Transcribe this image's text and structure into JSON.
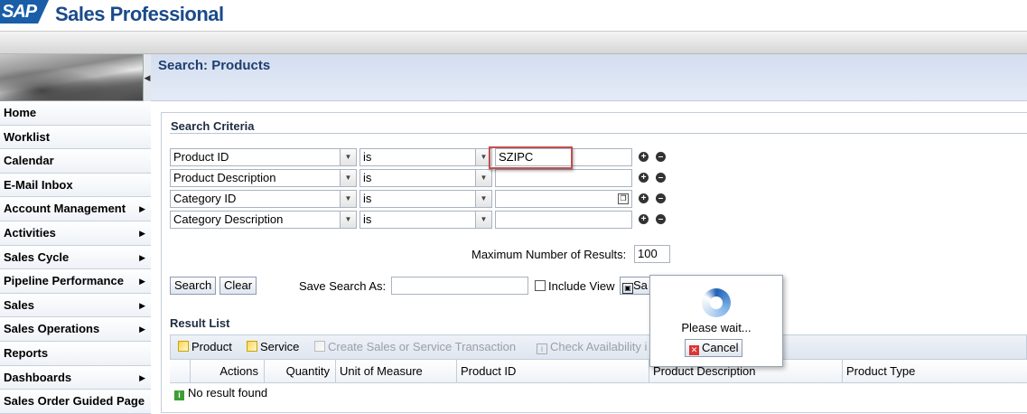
{
  "app": {
    "logo": "SAP",
    "title": "Sales Professional"
  },
  "page": {
    "title": "Search: Products"
  },
  "nav": {
    "items": [
      {
        "label": "Home",
        "has_submenu": false
      },
      {
        "label": "Worklist",
        "has_submenu": false
      },
      {
        "label": "Calendar",
        "has_submenu": false
      },
      {
        "label": "E-Mail Inbox",
        "has_submenu": false
      },
      {
        "label": "Account Management",
        "has_submenu": true
      },
      {
        "label": "Activities",
        "has_submenu": true
      },
      {
        "label": "Sales Cycle",
        "has_submenu": true
      },
      {
        "label": "Pipeline Performance",
        "has_submenu": true
      },
      {
        "label": "Sales",
        "has_submenu": true
      },
      {
        "label": "Sales Operations",
        "has_submenu": true
      },
      {
        "label": "Reports",
        "has_submenu": false
      },
      {
        "label": "Dashboards",
        "has_submenu": true
      },
      {
        "label": "Sales Order Guided Page",
        "has_submenu": false
      }
    ],
    "collapse_icon": "chevron-left-icon"
  },
  "criteria": {
    "title": "Search Criteria",
    "rows": [
      {
        "field": "Product ID",
        "operator": "is",
        "value": "SZIPC",
        "has_value_help": false
      },
      {
        "field": "Product Description",
        "operator": "is",
        "value": "",
        "has_value_help": false
      },
      {
        "field": "Category ID",
        "operator": "is",
        "value": "",
        "has_value_help": true
      },
      {
        "field": "Category Description",
        "operator": "is",
        "value": "",
        "has_value_help": false
      }
    ],
    "max_results_label": "Maximum Number of Results:",
    "max_results_value": "100",
    "search_button": "Search",
    "clear_button": "Clear",
    "save_search_label": "Save Search As:",
    "save_search_value": "",
    "include_view_label": "Include View",
    "save_button_partial": "Sa"
  },
  "results": {
    "title": "Result List",
    "toolbar": [
      {
        "label": "Product",
        "enabled": true,
        "icon": "new-icon"
      },
      {
        "label": "Service",
        "enabled": true,
        "icon": "new-icon"
      },
      {
        "label": "Create Sales or Service Transaction",
        "enabled": false,
        "icon": "new-icon"
      },
      {
        "label": "Check Availability i",
        "enabled": false,
        "icon": "info-icon"
      }
    ],
    "columns": [
      "Actions",
      "Quantity",
      "Unit of Measure",
      "Product ID",
      "Product Description",
      "Product Type"
    ],
    "empty_message": "No result found"
  },
  "popup": {
    "message": "Please wait...",
    "cancel_button": "Cancel"
  },
  "colors": {
    "brand_blue": "#1a5ea8",
    "highlight_red": "#c0504d",
    "title_blue": "#1d3f6e"
  }
}
